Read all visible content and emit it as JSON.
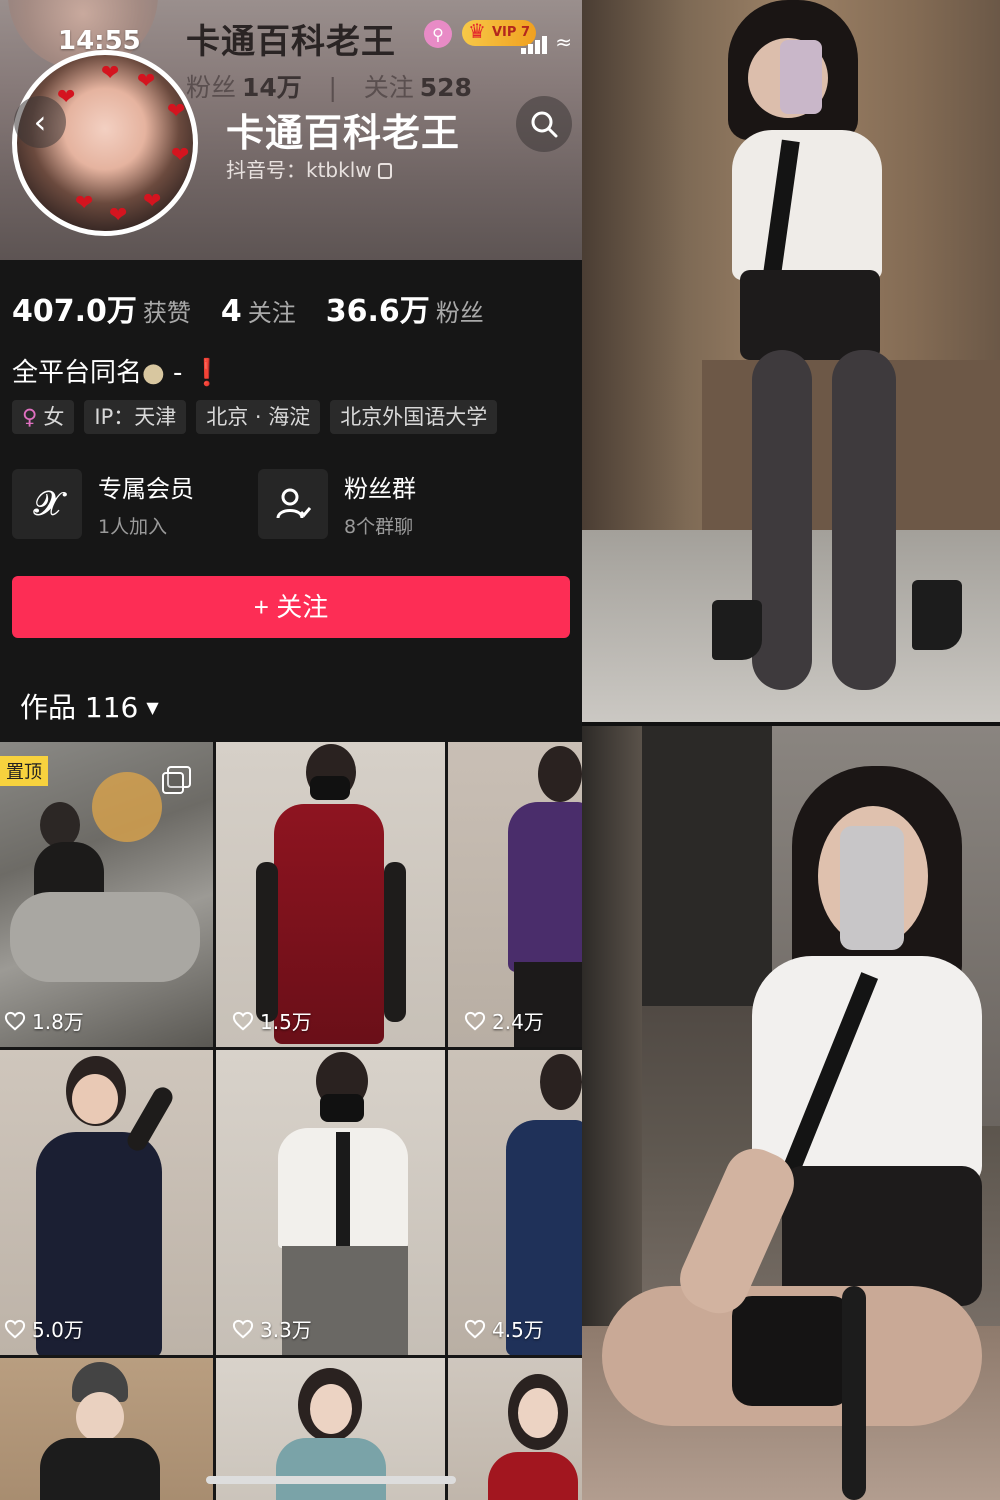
{
  "status_bar": {
    "time": "14:55"
  },
  "sticky_header": {
    "name": "卡通百科老王",
    "vip": "VIP 7",
    "followers_label": "粉丝",
    "followers": "14万",
    "following_label": "关注",
    "following": "528"
  },
  "profile": {
    "name": "卡通百科老王",
    "douyin_id": "抖音号：ktbklw",
    "stats": [
      {
        "num": "407.0万",
        "label": "获赞"
      },
      {
        "num": "4",
        "label": "关注"
      },
      {
        "num": "36.6万",
        "label": "粉丝"
      }
    ],
    "bio": "全平台同名",
    "tags": [
      "女",
      "IP：天津",
      "北京 · 海淀",
      "北京外国语大学"
    ],
    "cards": [
      {
        "title": "专属会员",
        "sub": "1人加入"
      },
      {
        "title": "粉丝群",
        "sub": "8个群聊"
      }
    ],
    "follow_label": "+ 关注",
    "works_label": "作品 116"
  },
  "works": [
    {
      "likes": "1.8万",
      "pinned": "置顶"
    },
    {
      "likes": "1.5万"
    },
    {
      "likes": "2.4万"
    },
    {
      "likes": "5.0万"
    },
    {
      "likes": "3.3万"
    },
    {
      "likes": "4.5万"
    },
    {
      "likes": ""
    },
    {
      "likes": ""
    },
    {
      "likes": ""
    }
  ],
  "colors": {
    "follow_button": "#fd2d55",
    "pinned_tag": "#f7d23e",
    "page_bg": "#161616"
  }
}
